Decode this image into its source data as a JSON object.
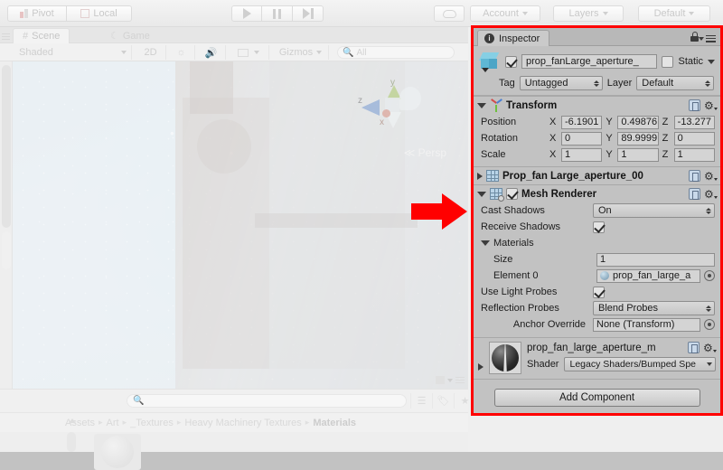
{
  "toolbar": {
    "pivot_label": "Pivot",
    "local_label": "Local",
    "play_icon": "play-icon",
    "pause_icon": "pause-icon",
    "step_icon": "step-icon",
    "cloud_icon": "cloud-icon",
    "account_label": "Account",
    "layers_label": "Layers",
    "layout_label": "Default"
  },
  "scene_panel": {
    "tabs": [
      {
        "label": "Scene",
        "icon": "grid-hash-icon",
        "active": true
      },
      {
        "label": "Game",
        "icon": "game-moon-icon",
        "active": false
      }
    ],
    "tools": {
      "draw_mode": "Shaded",
      "mode_2d": "2D",
      "lighting_icon": "sun-icon",
      "audio_icon": "speaker-icon",
      "effects_icon": "image-icon",
      "gizmos_label": "Gizmos",
      "search_placeholder": "All"
    },
    "viewport": {
      "projection_label": "Persp",
      "gizmo_axis_z": "z",
      "gizmo_axis_y": "y",
      "gizmo_axis_x": "x"
    },
    "bottom_bar": {
      "search_placeholder": "",
      "icons": [
        "layers-toggle-icon",
        "tag-icon",
        "favorite-star-icon"
      ]
    }
  },
  "project_panel": {
    "breadcrumb": [
      "Assets",
      "Art",
      "_Textures",
      "Heavy Machinery Textures",
      "Materials"
    ],
    "separator": "▸"
  },
  "inspector": {
    "tab_label": "Inspector",
    "tab_icon": "info-icon",
    "lock_icon": "lock-icon",
    "menu_icon": "hamburger-menu-icon",
    "object": {
      "enabled": true,
      "name": "prop_fanLarge_aperture_",
      "static_label": "Static",
      "tag_label": "Tag",
      "tag_value": "Untagged",
      "layer_label": "Layer",
      "layer_value": "Default"
    },
    "transform": {
      "title": "Transform",
      "rows": [
        {
          "label": "Position",
          "x": "-6.1901",
          "y": "0.49876",
          "z": "-13.277"
        },
        {
          "label": "Rotation",
          "x": "0",
          "y": "89.9999",
          "z": "0"
        },
        {
          "label": "Scale",
          "x": "1",
          "y": "1",
          "z": "1"
        }
      ],
      "axis_labels": [
        "X",
        "Y",
        "Z"
      ]
    },
    "mesh_filter": {
      "title": "Prop_fan Large_aperture_00"
    },
    "mesh_renderer": {
      "title": "Mesh Renderer",
      "enabled": true,
      "cast_shadows_label": "Cast Shadows",
      "cast_shadows_value": "On",
      "receive_shadows_label": "Receive Shadows",
      "receive_shadows_value": true,
      "materials_label": "Materials",
      "size_label": "Size",
      "size_value": "1",
      "element_label": "Element 0",
      "element_value": "prop_fan_large_a",
      "use_light_probes_label": "Use Light Probes",
      "use_light_probes_value": true,
      "reflection_probes_label": "Reflection Probes",
      "reflection_probes_value": "Blend Probes",
      "anchor_override_label": "Anchor Override",
      "anchor_override_value": "None (Transform)"
    },
    "material": {
      "name": "prop_fan_large_aperture_m",
      "shader_label": "Shader",
      "shader_value": "Legacy Shaders/Bumped Spe"
    },
    "add_component_label": "Add Component"
  },
  "annotation": {
    "arrow_color": "#ff0000",
    "highlight_color": "#ff0000"
  }
}
